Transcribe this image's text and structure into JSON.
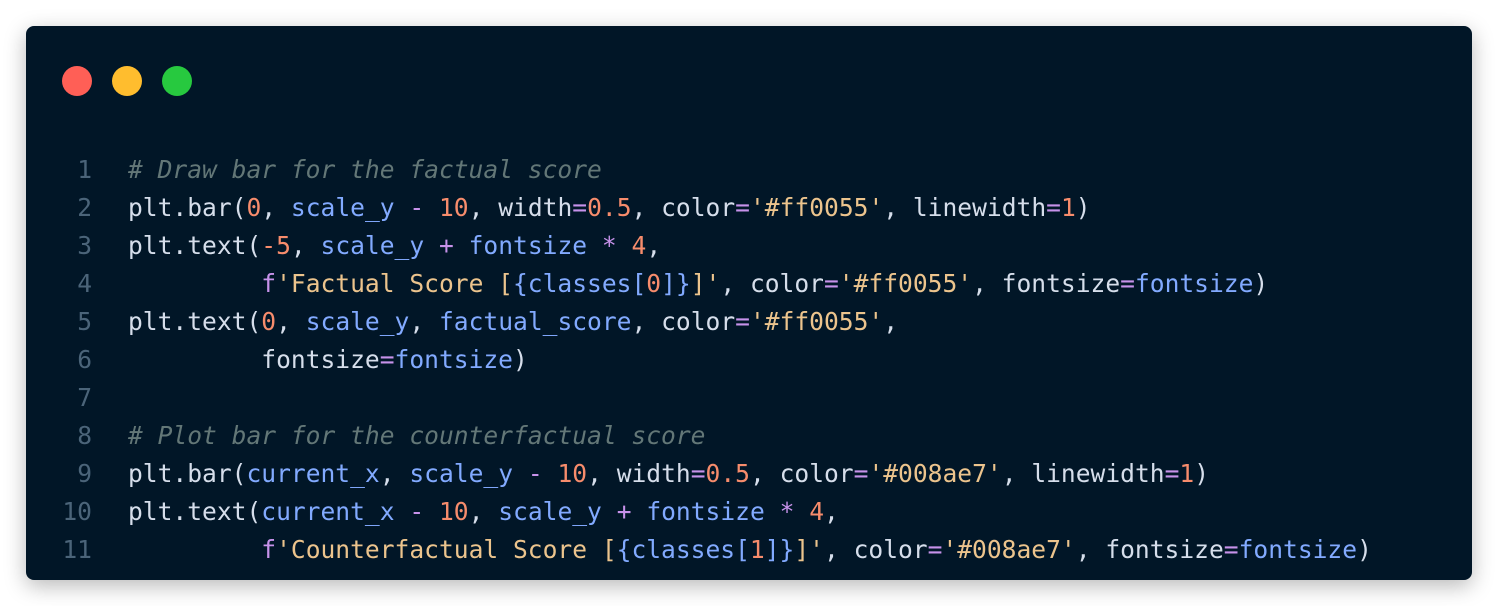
{
  "window": {
    "controls": [
      {
        "name": "close",
        "color": "#ff5f56"
      },
      {
        "name": "minimize",
        "color": "#ffbd2e"
      },
      {
        "name": "maximize",
        "color": "#27c93f"
      }
    ]
  },
  "code": {
    "language": "python",
    "lines": [
      {
        "num": "1",
        "tokens": [
          {
            "t": "comment",
            "v": "# Draw bar for the factual score"
          }
        ]
      },
      {
        "num": "2",
        "tokens": [
          {
            "t": "plain",
            "v": "plt.bar("
          },
          {
            "t": "num",
            "v": "0"
          },
          {
            "t": "plain",
            "v": ", "
          },
          {
            "t": "var",
            "v": "scale_y"
          },
          {
            "t": "plain",
            "v": " "
          },
          {
            "t": "op",
            "v": "-"
          },
          {
            "t": "plain",
            "v": " "
          },
          {
            "t": "num",
            "v": "10"
          },
          {
            "t": "plain",
            "v": ", width"
          },
          {
            "t": "op",
            "v": "="
          },
          {
            "t": "num",
            "v": "0.5"
          },
          {
            "t": "plain",
            "v": ", color"
          },
          {
            "t": "op",
            "v": "="
          },
          {
            "t": "str",
            "v": "'#ff0055'"
          },
          {
            "t": "plain",
            "v": ", linewidth"
          },
          {
            "t": "op",
            "v": "="
          },
          {
            "t": "num",
            "v": "1"
          },
          {
            "t": "plain",
            "v": ")"
          }
        ]
      },
      {
        "num": "3",
        "tokens": [
          {
            "t": "plain",
            "v": "plt.text("
          },
          {
            "t": "num",
            "v": "-5"
          },
          {
            "t": "plain",
            "v": ", "
          },
          {
            "t": "var",
            "v": "scale_y"
          },
          {
            "t": "plain",
            "v": " "
          },
          {
            "t": "op",
            "v": "+"
          },
          {
            "t": "plain",
            "v": " "
          },
          {
            "t": "var",
            "v": "fontsize"
          },
          {
            "t": "plain",
            "v": " "
          },
          {
            "t": "op",
            "v": "*"
          },
          {
            "t": "plain",
            "v": " "
          },
          {
            "t": "num",
            "v": "4"
          },
          {
            "t": "plain",
            "v": ","
          }
        ]
      },
      {
        "num": "4",
        "tokens": [
          {
            "t": "plain",
            "v": "         "
          },
          {
            "t": "op",
            "v": "f"
          },
          {
            "t": "str",
            "v": "'Factual Score ["
          },
          {
            "t": "var",
            "v": "{classes["
          },
          {
            "t": "num",
            "v": "0"
          },
          {
            "t": "var",
            "v": "]}"
          },
          {
            "t": "str",
            "v": "]'"
          },
          {
            "t": "plain",
            "v": ", color"
          },
          {
            "t": "op",
            "v": "="
          },
          {
            "t": "str",
            "v": "'#ff0055'"
          },
          {
            "t": "plain",
            "v": ", fontsize"
          },
          {
            "t": "op",
            "v": "="
          },
          {
            "t": "var",
            "v": "fontsize"
          },
          {
            "t": "plain",
            "v": ")"
          }
        ]
      },
      {
        "num": "5",
        "tokens": [
          {
            "t": "plain",
            "v": "plt.text("
          },
          {
            "t": "num",
            "v": "0"
          },
          {
            "t": "plain",
            "v": ", "
          },
          {
            "t": "var",
            "v": "scale_y"
          },
          {
            "t": "plain",
            "v": ", "
          },
          {
            "t": "var",
            "v": "factual_score"
          },
          {
            "t": "plain",
            "v": ", color"
          },
          {
            "t": "op",
            "v": "="
          },
          {
            "t": "str",
            "v": "'#ff0055'"
          },
          {
            "t": "plain",
            "v": ","
          }
        ]
      },
      {
        "num": "6",
        "tokens": [
          {
            "t": "plain",
            "v": "         fontsize"
          },
          {
            "t": "op",
            "v": "="
          },
          {
            "t": "var",
            "v": "fontsize"
          },
          {
            "t": "plain",
            "v": ")"
          }
        ]
      },
      {
        "num": "7",
        "tokens": []
      },
      {
        "num": "8",
        "tokens": [
          {
            "t": "comment",
            "v": "# Plot bar for the counterfactual score"
          }
        ]
      },
      {
        "num": "9",
        "tokens": [
          {
            "t": "plain",
            "v": "plt.bar("
          },
          {
            "t": "var",
            "v": "current_x"
          },
          {
            "t": "plain",
            "v": ", "
          },
          {
            "t": "var",
            "v": "scale_y"
          },
          {
            "t": "plain",
            "v": " "
          },
          {
            "t": "op",
            "v": "-"
          },
          {
            "t": "plain",
            "v": " "
          },
          {
            "t": "num",
            "v": "10"
          },
          {
            "t": "plain",
            "v": ", width"
          },
          {
            "t": "op",
            "v": "="
          },
          {
            "t": "num",
            "v": "0.5"
          },
          {
            "t": "plain",
            "v": ", color"
          },
          {
            "t": "op",
            "v": "="
          },
          {
            "t": "str",
            "v": "'#008ae7'"
          },
          {
            "t": "plain",
            "v": ", linewidth"
          },
          {
            "t": "op",
            "v": "="
          },
          {
            "t": "num",
            "v": "1"
          },
          {
            "t": "plain",
            "v": ")"
          }
        ]
      },
      {
        "num": "10",
        "tokens": [
          {
            "t": "plain",
            "v": "plt.text("
          },
          {
            "t": "var",
            "v": "current_x"
          },
          {
            "t": "plain",
            "v": " "
          },
          {
            "t": "op",
            "v": "-"
          },
          {
            "t": "plain",
            "v": " "
          },
          {
            "t": "num",
            "v": "10"
          },
          {
            "t": "plain",
            "v": ", "
          },
          {
            "t": "var",
            "v": "scale_y"
          },
          {
            "t": "plain",
            "v": " "
          },
          {
            "t": "op",
            "v": "+"
          },
          {
            "t": "plain",
            "v": " "
          },
          {
            "t": "var",
            "v": "fontsize"
          },
          {
            "t": "plain",
            "v": " "
          },
          {
            "t": "op",
            "v": "*"
          },
          {
            "t": "plain",
            "v": " "
          },
          {
            "t": "num",
            "v": "4"
          },
          {
            "t": "plain",
            "v": ","
          }
        ]
      },
      {
        "num": "11",
        "tokens": [
          {
            "t": "plain",
            "v": "         "
          },
          {
            "t": "op",
            "v": "f"
          },
          {
            "t": "str",
            "v": "'Counterfactual Score ["
          },
          {
            "t": "var",
            "v": "{classes["
          },
          {
            "t": "num",
            "v": "1"
          },
          {
            "t": "var",
            "v": "]}"
          },
          {
            "t": "str",
            "v": "]'"
          },
          {
            "t": "plain",
            "v": ", color"
          },
          {
            "t": "op",
            "v": "="
          },
          {
            "t": "str",
            "v": "'#008ae7'"
          },
          {
            "t": "plain",
            "v": ", fontsize"
          },
          {
            "t": "op",
            "v": "="
          },
          {
            "t": "var",
            "v": "fontsize"
          },
          {
            "t": "plain",
            "v": ")"
          }
        ]
      }
    ]
  }
}
